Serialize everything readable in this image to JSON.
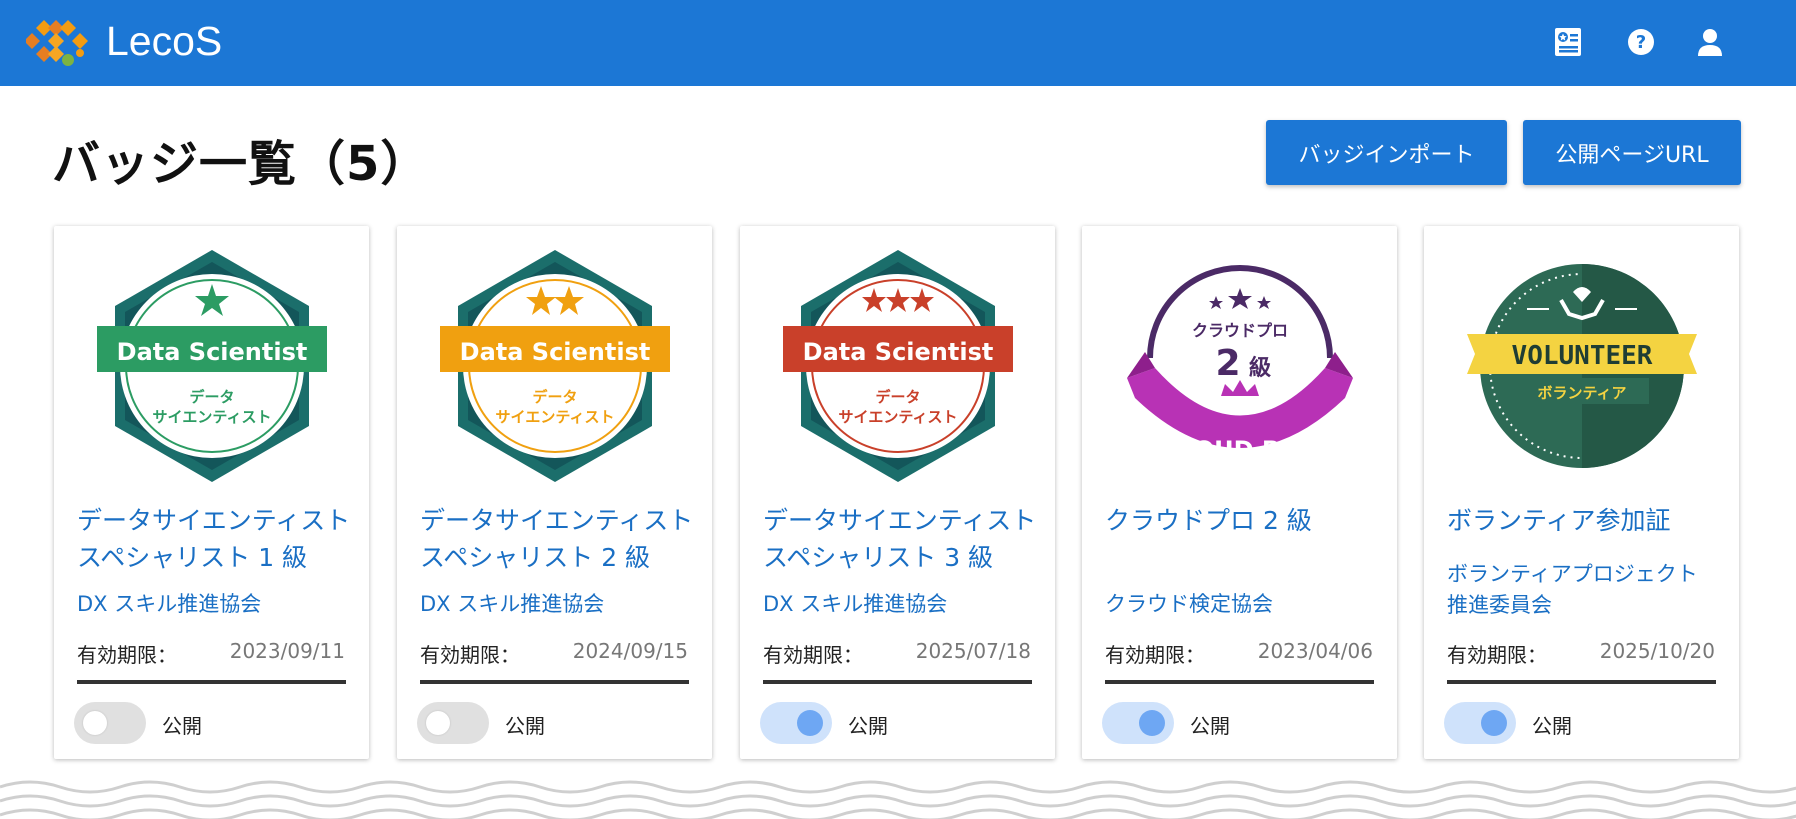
{
  "app": {
    "name": "LecoS"
  },
  "header": {
    "icons": [
      "badge-book-icon",
      "help-icon",
      "user-icon"
    ]
  },
  "page": {
    "title": "バッジ一覧（5）"
  },
  "actions": {
    "import_label": "バッジインポート",
    "public_url_label": "公開ページURL"
  },
  "colors": {
    "primary": "#1c77d5",
    "link": "#1a6fc4"
  },
  "badges": [
    {
      "title_line1": "データサイエンティスト",
      "title_line2": "スペシャリスト 1 級",
      "issuer_line1": "DX スキル推進協会",
      "issuer_line2": "",
      "expiry_label": "有効期限：",
      "expiry": "2023/09/11",
      "toggle_label": "公開",
      "public": false,
      "image": {
        "banner": "Data Scientist",
        "jp1": "データ",
        "jp2": "サイエンティスト",
        "stars": 1,
        "color": "#2c9c63"
      }
    },
    {
      "title_line1": "データサイエンティスト",
      "title_line2": "スペシャリスト 2 級",
      "issuer_line1": "DX スキル推進協会",
      "issuer_line2": "",
      "expiry_label": "有効期限：",
      "expiry": "2024/09/15",
      "toggle_label": "公開",
      "public": false,
      "image": {
        "banner": "Data Scientist",
        "jp1": "データ",
        "jp2": "サイエンティスト",
        "stars": 2,
        "color": "#f0a010"
      }
    },
    {
      "title_line1": "データサイエンティスト",
      "title_line2": "スペシャリスト 3 級",
      "issuer_line1": "DX スキル推進協会",
      "issuer_line2": "",
      "expiry_label": "有効期限：",
      "expiry": "2025/07/18",
      "toggle_label": "公開",
      "public": true,
      "image": {
        "banner": "Data Scientist",
        "jp1": "データ",
        "jp2": "サイエンティスト",
        "stars": 3,
        "color": "#c9402a"
      }
    },
    {
      "title_line1": "クラウドプロ 2 級",
      "title_line2": "",
      "issuer_line1": "クラウド検定協会",
      "issuer_line2": "",
      "expiry_label": "有効期限：",
      "expiry": "2023/04/06",
      "toggle_label": "公開",
      "public": true,
      "image": {
        "top": "クラウドプロ",
        "level": "2",
        "level_unit": "級",
        "ribbon": "CLOUD PRO",
        "color": "#b832b5"
      }
    },
    {
      "title_line1": "ボランティア参加証",
      "title_line2": "",
      "issuer_line1": "ボランティアプロジェクト",
      "issuer_line2": "推進委員会",
      "expiry_label": "有効期限：",
      "expiry": "2025/10/20",
      "toggle_label": "公開",
      "public": true,
      "image": {
        "banner": "VOLUNTEER",
        "sub": "ボランティア",
        "color": "#2d6a55"
      }
    }
  ]
}
